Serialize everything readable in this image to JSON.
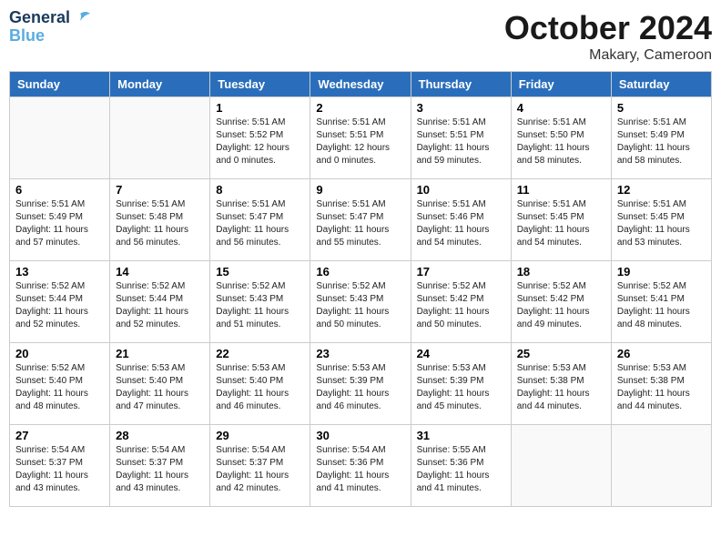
{
  "header": {
    "logo_line1": "General",
    "logo_line2": "Blue",
    "month": "October 2024",
    "location": "Makary, Cameroon"
  },
  "weekdays": [
    "Sunday",
    "Monday",
    "Tuesday",
    "Wednesday",
    "Thursday",
    "Friday",
    "Saturday"
  ],
  "weeks": [
    [
      {
        "day": "",
        "info": ""
      },
      {
        "day": "",
        "info": ""
      },
      {
        "day": "1",
        "sunrise": "5:51 AM",
        "sunset": "5:52 PM",
        "daylight": "12 hours and 0 minutes."
      },
      {
        "day": "2",
        "sunrise": "5:51 AM",
        "sunset": "5:51 PM",
        "daylight": "12 hours and 0 minutes."
      },
      {
        "day": "3",
        "sunrise": "5:51 AM",
        "sunset": "5:51 PM",
        "daylight": "11 hours and 59 minutes."
      },
      {
        "day": "4",
        "sunrise": "5:51 AM",
        "sunset": "5:50 PM",
        "daylight": "11 hours and 58 minutes."
      },
      {
        "day": "5",
        "sunrise": "5:51 AM",
        "sunset": "5:49 PM",
        "daylight": "11 hours and 58 minutes."
      }
    ],
    [
      {
        "day": "6",
        "sunrise": "5:51 AM",
        "sunset": "5:49 PM",
        "daylight": "11 hours and 57 minutes."
      },
      {
        "day": "7",
        "sunrise": "5:51 AM",
        "sunset": "5:48 PM",
        "daylight": "11 hours and 56 minutes."
      },
      {
        "day": "8",
        "sunrise": "5:51 AM",
        "sunset": "5:47 PM",
        "daylight": "11 hours and 56 minutes."
      },
      {
        "day": "9",
        "sunrise": "5:51 AM",
        "sunset": "5:47 PM",
        "daylight": "11 hours and 55 minutes."
      },
      {
        "day": "10",
        "sunrise": "5:51 AM",
        "sunset": "5:46 PM",
        "daylight": "11 hours and 54 minutes."
      },
      {
        "day": "11",
        "sunrise": "5:51 AM",
        "sunset": "5:45 PM",
        "daylight": "11 hours and 54 minutes."
      },
      {
        "day": "12",
        "sunrise": "5:51 AM",
        "sunset": "5:45 PM",
        "daylight": "11 hours and 53 minutes."
      }
    ],
    [
      {
        "day": "13",
        "sunrise": "5:52 AM",
        "sunset": "5:44 PM",
        "daylight": "11 hours and 52 minutes."
      },
      {
        "day": "14",
        "sunrise": "5:52 AM",
        "sunset": "5:44 PM",
        "daylight": "11 hours and 52 minutes."
      },
      {
        "day": "15",
        "sunrise": "5:52 AM",
        "sunset": "5:43 PM",
        "daylight": "11 hours and 51 minutes."
      },
      {
        "day": "16",
        "sunrise": "5:52 AM",
        "sunset": "5:43 PM",
        "daylight": "11 hours and 50 minutes."
      },
      {
        "day": "17",
        "sunrise": "5:52 AM",
        "sunset": "5:42 PM",
        "daylight": "11 hours and 50 minutes."
      },
      {
        "day": "18",
        "sunrise": "5:52 AM",
        "sunset": "5:42 PM",
        "daylight": "11 hours and 49 minutes."
      },
      {
        "day": "19",
        "sunrise": "5:52 AM",
        "sunset": "5:41 PM",
        "daylight": "11 hours and 48 minutes."
      }
    ],
    [
      {
        "day": "20",
        "sunrise": "5:52 AM",
        "sunset": "5:40 PM",
        "daylight": "11 hours and 48 minutes."
      },
      {
        "day": "21",
        "sunrise": "5:53 AM",
        "sunset": "5:40 PM",
        "daylight": "11 hours and 47 minutes."
      },
      {
        "day": "22",
        "sunrise": "5:53 AM",
        "sunset": "5:40 PM",
        "daylight": "11 hours and 46 minutes."
      },
      {
        "day": "23",
        "sunrise": "5:53 AM",
        "sunset": "5:39 PM",
        "daylight": "11 hours and 46 minutes."
      },
      {
        "day": "24",
        "sunrise": "5:53 AM",
        "sunset": "5:39 PM",
        "daylight": "11 hours and 45 minutes."
      },
      {
        "day": "25",
        "sunrise": "5:53 AM",
        "sunset": "5:38 PM",
        "daylight": "11 hours and 44 minutes."
      },
      {
        "day": "26",
        "sunrise": "5:53 AM",
        "sunset": "5:38 PM",
        "daylight": "11 hours and 44 minutes."
      }
    ],
    [
      {
        "day": "27",
        "sunrise": "5:54 AM",
        "sunset": "5:37 PM",
        "daylight": "11 hours and 43 minutes."
      },
      {
        "day": "28",
        "sunrise": "5:54 AM",
        "sunset": "5:37 PM",
        "daylight": "11 hours and 43 minutes."
      },
      {
        "day": "29",
        "sunrise": "5:54 AM",
        "sunset": "5:37 PM",
        "daylight": "11 hours and 42 minutes."
      },
      {
        "day": "30",
        "sunrise": "5:54 AM",
        "sunset": "5:36 PM",
        "daylight": "11 hours and 41 minutes."
      },
      {
        "day": "31",
        "sunrise": "5:55 AM",
        "sunset": "5:36 PM",
        "daylight": "11 hours and 41 minutes."
      },
      {
        "day": "",
        "info": ""
      },
      {
        "day": "",
        "info": ""
      }
    ]
  ]
}
